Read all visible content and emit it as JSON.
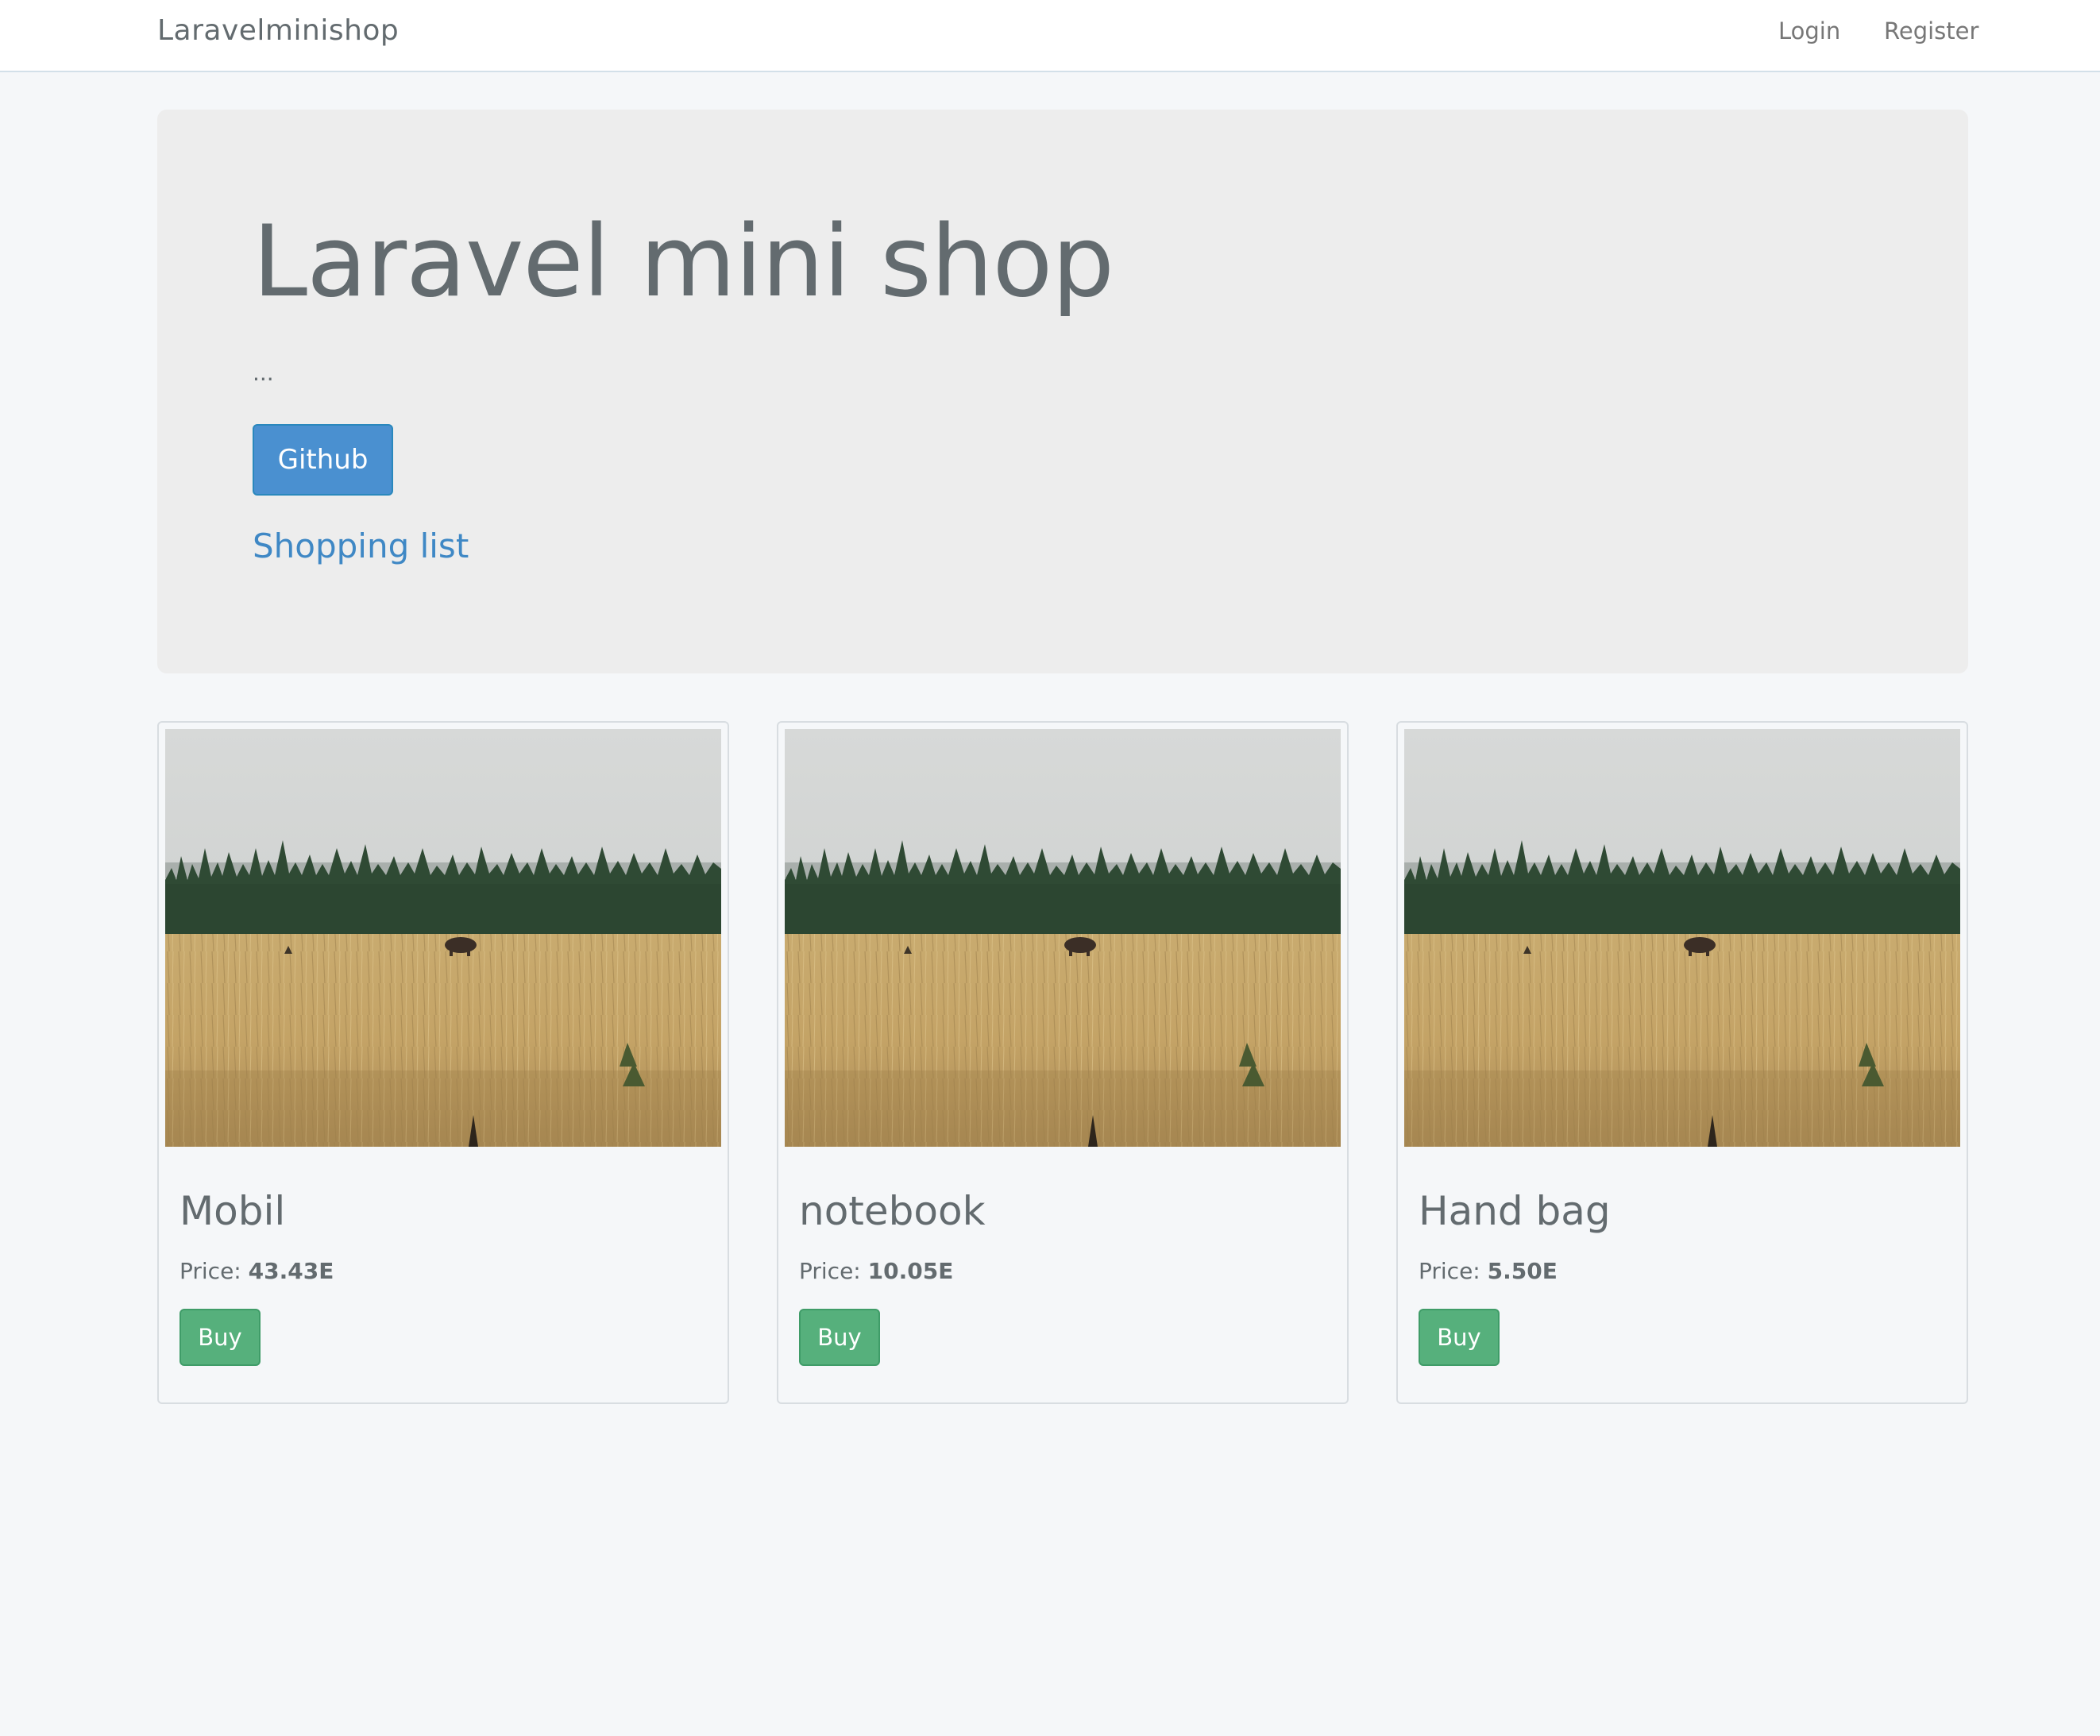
{
  "navbar": {
    "brand": "Laravelminishop",
    "links": [
      "Login",
      "Register"
    ]
  },
  "hero": {
    "title": "Laravel mini shop",
    "lead": "...",
    "github_button": "Github",
    "shopping_link": "Shopping list"
  },
  "products": [
    {
      "name": "Mobil",
      "price_label": "Price:",
      "price": "43.43E",
      "buy_label": "Buy",
      "image": "prairie-bison-photo"
    },
    {
      "name": "notebook",
      "price_label": "Price:",
      "price": "10.05E",
      "buy_label": "Buy",
      "image": "prairie-bison-photo"
    },
    {
      "name": "Hand bag",
      "price_label": "Price:",
      "price": "5.50E",
      "buy_label": "Buy",
      "image": "prairie-bison-photo"
    }
  ],
  "colors": {
    "page_bg": "#f5f7f9",
    "jumbotron_bg": "#ededed",
    "primary_button": "#4a90d0",
    "success_button": "#56b07c",
    "link": "#3f88c5"
  }
}
